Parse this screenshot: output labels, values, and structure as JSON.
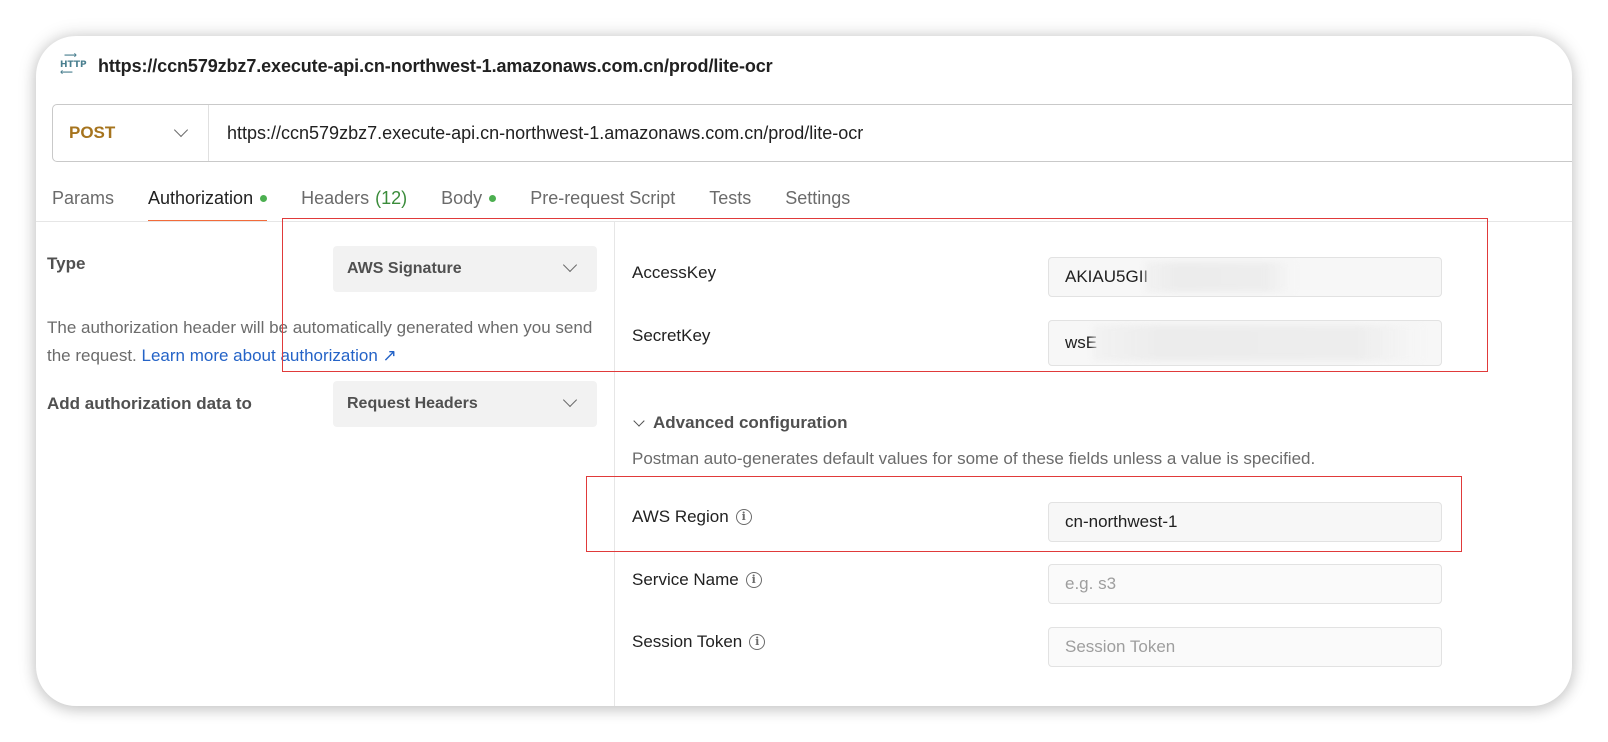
{
  "title": {
    "url": "https://ccn579zbz7.execute-api.cn-northwest-1.amazonaws.com.cn/prod/lite-ocr",
    "icon": "http-icon"
  },
  "request": {
    "method": "POST",
    "url": "https://ccn579zbz7.execute-api.cn-northwest-1.amazonaws.com.cn/prod/lite-ocr"
  },
  "tabs": [
    {
      "label": "Params"
    },
    {
      "label": "Authorization"
    },
    {
      "label": "Headers",
      "count": "(12)"
    },
    {
      "label": "Body"
    },
    {
      "label": "Pre-request Script"
    },
    {
      "label": "Tests"
    },
    {
      "label": "Settings"
    }
  ],
  "auth": {
    "type_label": "Type",
    "type_value": "AWS Signature",
    "description": "The authorization header will be automatically generated when you send the request.",
    "learn_more": "Learn more about authorization ↗",
    "add_to_label": "Add authorization data to",
    "add_to_value": "Request Headers"
  },
  "fields": {
    "access_key_label": "AccessKey",
    "access_key_value": "AKIAU5GII",
    "secret_key_label": "SecretKey",
    "secret_key_value": "wsE",
    "advanced_label": "Advanced configuration",
    "advanced_desc": "Postman auto-generates default values for some of these fields unless a value is specified.",
    "region_label": "AWS Region",
    "region_value": "cn-northwest-1",
    "service_label": "Service Name",
    "service_placeholder": "e.g. s3",
    "session_label": "Session Token",
    "session_placeholder": "Session Token"
  },
  "colors": {
    "method": "#a6741e",
    "active_tab_underline": "#f26b3a",
    "status_dot": "#4caf50",
    "highlight": "#e03a3a",
    "link": "#2463c7"
  }
}
